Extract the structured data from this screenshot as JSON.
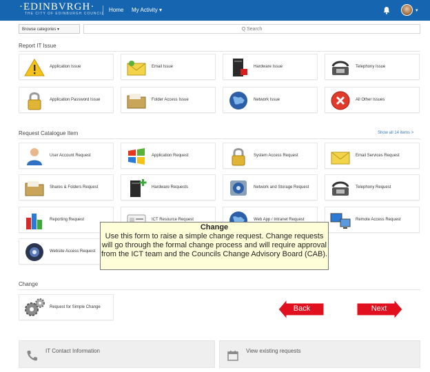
{
  "header": {
    "logo": "·EDINBVRGH·",
    "logo_sub": "THE CITY OF EDINBURGH COUNCIL",
    "nav_home": "Home",
    "nav_activity": "My Activity ▾",
    "brand_color": "#1565b0"
  },
  "toolbar": {
    "category_select": "Browse categories ▾",
    "search_placeholder": "Q Search"
  },
  "report_section": {
    "title": "Report IT Issue",
    "items": [
      {
        "label": "Application Issue",
        "icon": "warning-icon"
      },
      {
        "label": "Email Issue",
        "icon": "email-icon"
      },
      {
        "label": "Hardware Issue",
        "icon": "hardware-icon"
      },
      {
        "label": "Telephony Issue",
        "icon": "telephone-icon"
      },
      {
        "label": "Application Password Issue",
        "icon": "padlock-icon"
      },
      {
        "label": "Folder Access Issue",
        "icon": "folder-icon"
      },
      {
        "label": "Network Issue",
        "icon": "globe-icon"
      },
      {
        "label": "All Other Issues",
        "icon": "error-icon"
      }
    ]
  },
  "catalogue_section": {
    "title": "Request Catalogue Item",
    "show_all": "Show all 14 items >",
    "items": [
      {
        "label": "User Account Request",
        "icon": "user-icon"
      },
      {
        "label": "Application Request",
        "icon": "windows-icon"
      },
      {
        "label": "System Access Request",
        "icon": "padlock-icon"
      },
      {
        "label": "Email Services Request",
        "icon": "email-icon"
      },
      {
        "label": "Shares & Folders Request",
        "icon": "folder-icon"
      },
      {
        "label": "Hardware Requests",
        "icon": "hardware-add-icon"
      },
      {
        "label": "Network and Storage Request",
        "icon": "network-storage-icon"
      },
      {
        "label": "Telephony Request",
        "icon": "telephone-icon"
      },
      {
        "label": "Reporting Request",
        "icon": "bar-chart-icon"
      },
      {
        "label": "ICT Resource Request",
        "icon": "id-card-icon"
      },
      {
        "label": "Web App / Intranet Request",
        "icon": "globe-icon"
      },
      {
        "label": "Remote Access Request",
        "icon": "remote-access-icon"
      },
      {
        "label": "Website Access Request",
        "icon": "webcam-icon"
      }
    ]
  },
  "change_section": {
    "title": "Change",
    "items": [
      {
        "label": "Request for Simple Change",
        "icon": "gears-icon"
      }
    ]
  },
  "callout": {
    "title": "Change",
    "body": "Use this form to raise a simple change request. Change requests will go through the formal change process and will require approval from the ICT team and the Councils Change Advisory Board (CAB)."
  },
  "navigation": {
    "back": "Back",
    "next": "Next",
    "arrow_color": "#e0101e"
  },
  "footer": {
    "contact": "IT Contact Information",
    "requests": "View existing requests"
  }
}
